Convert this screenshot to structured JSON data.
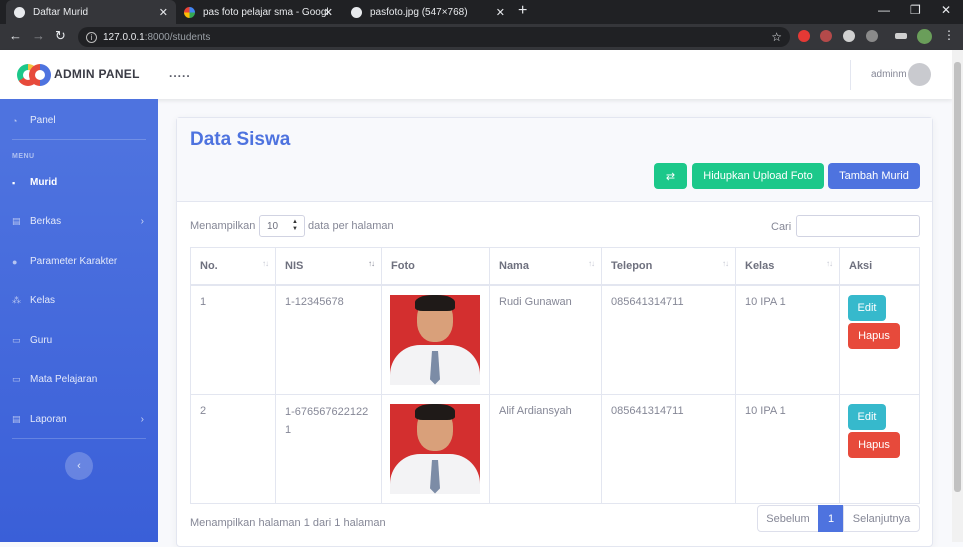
{
  "browser": {
    "tabs": [
      {
        "title": "Daftar Murid",
        "active": true
      },
      {
        "title": "pas foto pelajar sma - Google Se",
        "active": false
      },
      {
        "title": "pasfoto.jpg (547×768)",
        "active": false
      }
    ],
    "url_host": "127.0.0.1",
    "url_path": ":8000/students"
  },
  "topbar": {
    "brand": "ADMIN PANEL",
    "dots": ".....",
    "username": "adminm"
  },
  "sidebar": {
    "panel": "Panel",
    "heading": "MENU",
    "items": [
      {
        "label": "Murid",
        "icon": "user-graduate-icon",
        "active": true
      },
      {
        "label": "Berkas",
        "icon": "file-icon",
        "chevron": true
      },
      {
        "label": "Parameter Karakter",
        "icon": "circle-icon"
      },
      {
        "label": "Kelas",
        "icon": "users-icon"
      },
      {
        "label": "Guru",
        "icon": "chalkboard-icon"
      },
      {
        "label": "Mata Pelajaran",
        "icon": "chalkboard-icon"
      },
      {
        "label": "Laporan",
        "icon": "file-icon",
        "chevron": true
      }
    ]
  },
  "card": {
    "title": "Data Siswa",
    "btn_refresh": "⇄",
    "btn_upload": "Hidupkan Upload Foto",
    "btn_add": "Tambah Murid",
    "show_prefix": "Menampilkan",
    "per_page": "10",
    "show_suffix": "data per halaman",
    "search_label": "Cari",
    "columns": [
      "No.",
      "NIS",
      "Foto",
      "Nama",
      "Telepon",
      "Kelas",
      "Aksi"
    ],
    "rows": [
      {
        "no": "1",
        "nis": "1-12345678",
        "nama": "Rudi Gunawan",
        "telepon": "085641314711",
        "kelas": "10 IPA 1"
      },
      {
        "no": "2",
        "nis": "1-6765676221221",
        "nama": "Alif Ardiansyah",
        "telepon": "085641314711",
        "kelas": "10 IPA 1"
      }
    ],
    "edit_label": "Edit",
    "delete_label": "Hapus",
    "footer_info": "Menampilkan halaman 1 dari 1 halaman",
    "prev": "Sebelum",
    "page": "1",
    "next": "Selanjutnya"
  },
  "colors": {
    "primary": "#4e73df",
    "success": "#1cc88a",
    "info": "#36b9cc",
    "danger": "#e74a3b"
  }
}
